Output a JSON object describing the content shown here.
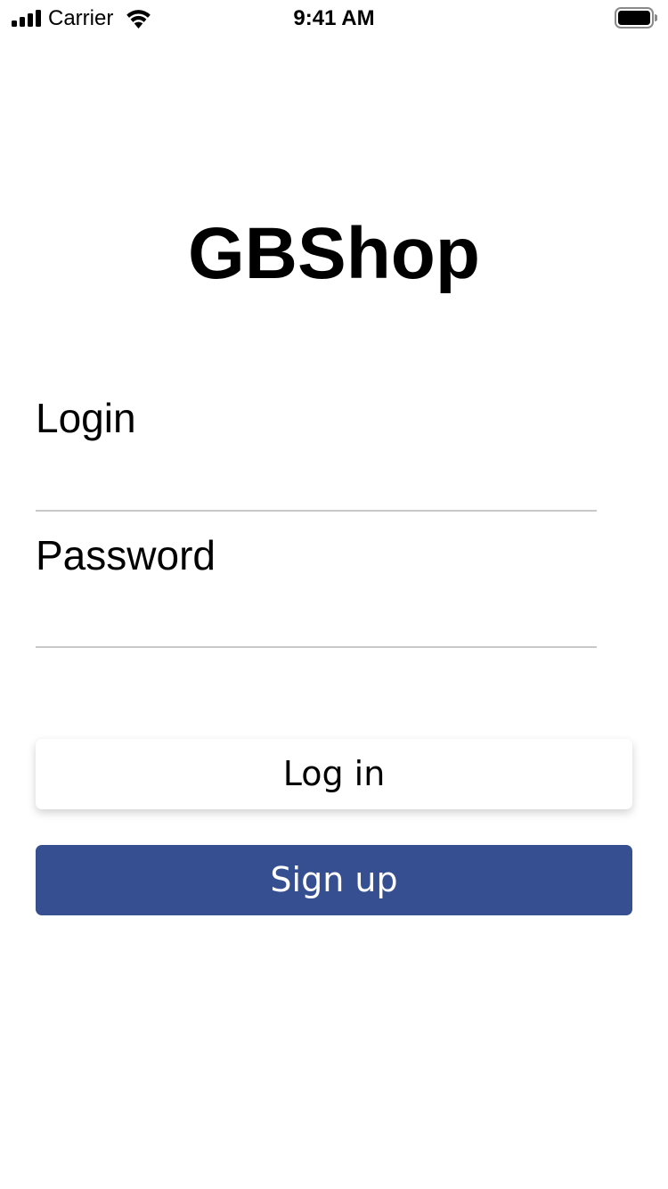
{
  "status_bar": {
    "carrier": "Carrier",
    "time": "9:41 AM",
    "icons": [
      "signal-icon",
      "wifi-icon",
      "battery-icon"
    ]
  },
  "app": {
    "title": "GBShop"
  },
  "form": {
    "login_label": "Login",
    "login_value": "",
    "password_label": "Password",
    "password_value": ""
  },
  "buttons": {
    "login_label": "Log in",
    "signup_label": "Sign up"
  },
  "colors": {
    "signup_background": "#364f91",
    "signup_text": "#ffffff",
    "login_background": "#ffffff",
    "divider": "#c8c8c8"
  }
}
